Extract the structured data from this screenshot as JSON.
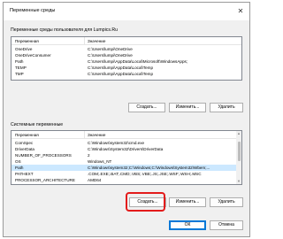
{
  "window": {
    "title": "Переменные среды",
    "close_glyph": "✕"
  },
  "user_vars": {
    "label": "Переменные среды пользователя для Lumpics.Ru",
    "columns": [
      "Переменная",
      "Значение"
    ],
    "rows": [
      [
        "OneDrive",
        "C:\\Users\\lumpi\\OneDrive"
      ],
      [
        "OneDriveConsumer",
        "C:\\Users\\lumpi\\OneDrive"
      ],
      [
        "Path",
        "C:\\Users\\lumpi\\AppData\\Local\\Microsoft\\WindowsApps;"
      ],
      [
        "TEMP",
        "C:\\Users\\lumpi\\AppData\\Local\\Temp"
      ],
      [
        "TMP",
        "C:\\Users\\lumpi\\AppData\\Local\\Temp"
      ]
    ],
    "buttons": {
      "create": "Создать...",
      "edit": "Изменить...",
      "delete": "Удалить"
    }
  },
  "system_vars": {
    "label": "Системные переменные",
    "columns": [
      "Переменная",
      "Значение"
    ],
    "rows": [
      [
        "ComSpec",
        "C:\\Windows\\system32\\cmd.exe"
      ],
      [
        "DriverData",
        "C:\\Windows\\System32\\Drivers\\DriverData"
      ],
      [
        "NUMBER_OF_PROCESSORS",
        "2"
      ],
      [
        "OS",
        "Windows_NT"
      ],
      [
        "Path",
        "C:\\Windows\\system32;C:\\Windows;C:\\Windows\\System32\\Wbem;..."
      ],
      [
        "PATHEXT",
        ".COM;.EXE;.BAT;.CMD;.VBS;.VBE;.JS;.JSE;.WSF;.WSH;.MSC"
      ],
      [
        "PROCESSOR_ARCHITECTURE",
        "AMD64"
      ]
    ],
    "buttons": {
      "create": "Создать...",
      "edit": "Изменить...",
      "delete": "Удалить"
    }
  },
  "footer": {
    "ok": "ОК",
    "cancel": "Отмена"
  },
  "colors": {
    "accent": "#0078d7",
    "highlight": "#e31b1b",
    "selected_row": "#cce8ff"
  }
}
